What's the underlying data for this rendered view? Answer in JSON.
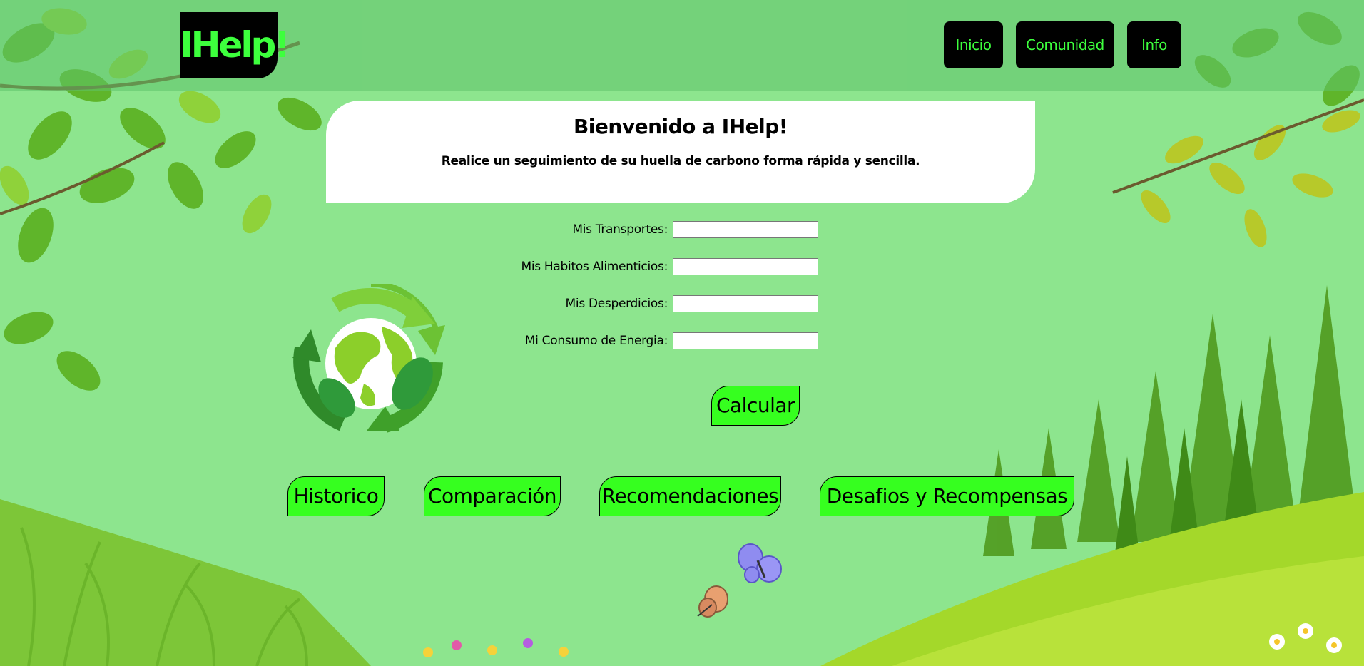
{
  "header": {
    "logo_text": "IHelp!",
    "nav": [
      {
        "label": "Inicio"
      },
      {
        "label": "Comunidad"
      },
      {
        "label": "Info"
      }
    ]
  },
  "welcome": {
    "title": "Bienvenido a IHelp!",
    "subtitle": "Realice un seguimiento de su huella de carbono forma rápida y sencilla."
  },
  "form": {
    "fields": [
      {
        "label": "Mis Transportes:",
        "value": ""
      },
      {
        "label": "Mis Habitos Alimenticios:",
        "value": ""
      },
      {
        "label": "Mis Desperdicios:",
        "value": ""
      },
      {
        "label": "Mi Consumo de Energia:",
        "value": ""
      }
    ],
    "submit_label": "Calcular"
  },
  "actions": [
    {
      "label": "Historico"
    },
    {
      "label": "Comparación"
    },
    {
      "label": "Recomendaciones"
    },
    {
      "label": "Desafios y Recompensas"
    }
  ],
  "images": {
    "emblem": "recycle-globe-icon",
    "decor": [
      "butterfly-icon",
      "butterfly-icon"
    ]
  },
  "colors": {
    "background": "#8de58e",
    "header_bg": "#5fc369",
    "button_green": "#36ff1f",
    "logo_text": "#3dff3d",
    "nav_bg": "#000000",
    "card_bg": "#ffffff"
  }
}
